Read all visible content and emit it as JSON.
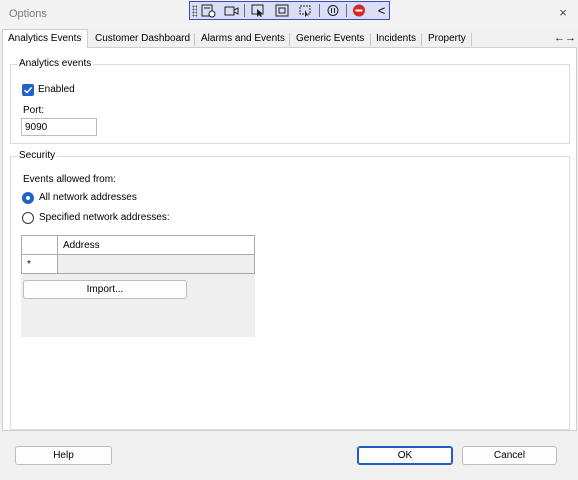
{
  "window": {
    "title": "Options",
    "close_glyph": "×"
  },
  "recording_toolbar": {
    "icons": [
      "settings-window-icon",
      "camera-icon",
      "select-pointer-icon",
      "stop-square-icon",
      "region-capture-icon",
      "pause-icon",
      "stop-record-icon",
      "collapse-chevron-icon"
    ],
    "collapse_glyph": "<"
  },
  "tabs": [
    {
      "label": "Analytics Events",
      "active": true
    },
    {
      "label": "Customer Dashboard",
      "active": false
    },
    {
      "label": "Alarms and Events",
      "active": false
    },
    {
      "label": "Generic Events",
      "active": false
    },
    {
      "label": "Incidents",
      "active": false
    },
    {
      "label": "Property",
      "active": false
    }
  ],
  "tab_scroll_glyph": "←→",
  "analytics_events": {
    "legend": "Analytics events",
    "enabled_label": "Enabled",
    "enabled_checked": true,
    "port_label": "Port:",
    "port_value": "9090"
  },
  "security": {
    "legend": "Security",
    "events_allowed_label": "Events allowed from:",
    "options": [
      {
        "label": "All network addresses",
        "checked": true
      },
      {
        "label": "Specified network addresses:",
        "checked": false
      }
    ],
    "table": {
      "column_header": "Address",
      "new_row_marker": "*"
    },
    "import_button": "Import..."
  },
  "footer": {
    "help": "Help",
    "ok": "OK",
    "cancel": "Cancel"
  },
  "colors": {
    "accent": "#1e63c8",
    "toolbar_bg": "#d9def5",
    "stop_red": "#d62828"
  }
}
